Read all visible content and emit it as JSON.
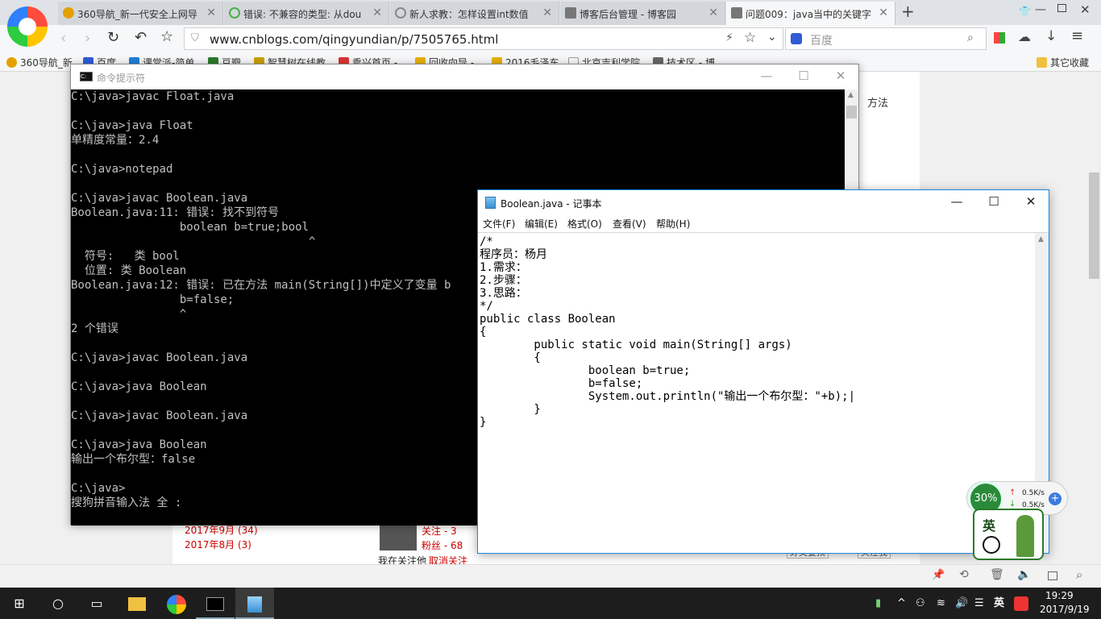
{
  "browser": {
    "tabs": [
      {
        "label": "360导航_新一代安全上网导",
        "icon_color": "#e3a000"
      },
      {
        "label": "错误: 不兼容的类型: 从dou",
        "icon_color": "#4ab04a"
      },
      {
        "label": "新人求教：怎样设置int数值",
        "icon_color": "#888888"
      },
      {
        "label": "博客后台管理 - 博客园",
        "icon_color": "#555555"
      },
      {
        "label": "问题009：java当中的关键字",
        "icon_color": "#555555"
      }
    ],
    "new_tab": "+",
    "url": "www.cnblogs.com/qingyundian/p/7505765.html",
    "search_placeholder": "百度",
    "bookmarks": [
      "360导航_新",
      "百度",
      "课堂派-简单",
      "豆瓣",
      "智慧树在线教",
      "乘兴首页 -",
      "回收向导 -",
      "2016毛泽东",
      "北京吉利学院",
      "技术区 - 博"
    ],
    "other_bookmarks": "其它收藏"
  },
  "page": {
    "side_text": "方法",
    "archive": [
      "2017年9月 (34)",
      "2017年8月 (3)"
    ],
    "follow": {
      "following": "关注 - 3",
      "fans": "粉丝 - 68",
      "line": "我在关注他",
      "cancel": "取消关注"
    },
    "buttons": [
      "好文要顶",
      "关注我"
    ]
  },
  "cmd": {
    "title": "命令提示符",
    "lines": [
      "C:\\java>javac Float.java",
      "",
      "C:\\java>java Float",
      "单精度常量：2.4",
      "",
      "C:\\java>notepad",
      "",
      "C:\\java>javac Boolean.java",
      "Boolean.java:11: 错误: 找不到符号",
      "                boolean b=true;bool",
      "                                   ^",
      "  符号:   类 bool",
      "  位置: 类 Boolean",
      "Boolean.java:12: 错误: 已在方法 main(String[])中定义了变量 b",
      "                b=false;",
      "                ^",
      "2 个错误",
      "",
      "C:\\java>javac Boolean.java",
      "",
      "C:\\java>java Boolean",
      "",
      "C:\\java>javac Boolean.java",
      "",
      "C:\\java>java Boolean",
      "输出一个布尔型：false",
      "",
      "C:\\java>",
      "搜狗拼音输入法 全 :"
    ]
  },
  "notepad": {
    "title": "Boolean.java - 记事本",
    "menu": [
      "文件(F)",
      "编辑(E)",
      "格式(O)",
      "查看(V)",
      "帮助(H)"
    ],
    "content": [
      "/*",
      "程序员：杨月",
      "1.需求：",
      "2.步骤：",
      "3.思路：",
      "*/",
      "public class Boolean",
      "{",
      "        public static void main(String[] args)",
      "        {",
      "                boolean b=true;",
      "                b=false;",
      "                System.out.println(\"输出一个布尔型：\"+b);|",
      "        }",
      "}"
    ]
  },
  "widget": {
    "percent": "30%",
    "up": "0.5K/s",
    "down": "0.5K/s",
    "ime": "英"
  },
  "taskbar": {
    "ime": "英",
    "time": "19:29",
    "date": "2017/9/19"
  }
}
